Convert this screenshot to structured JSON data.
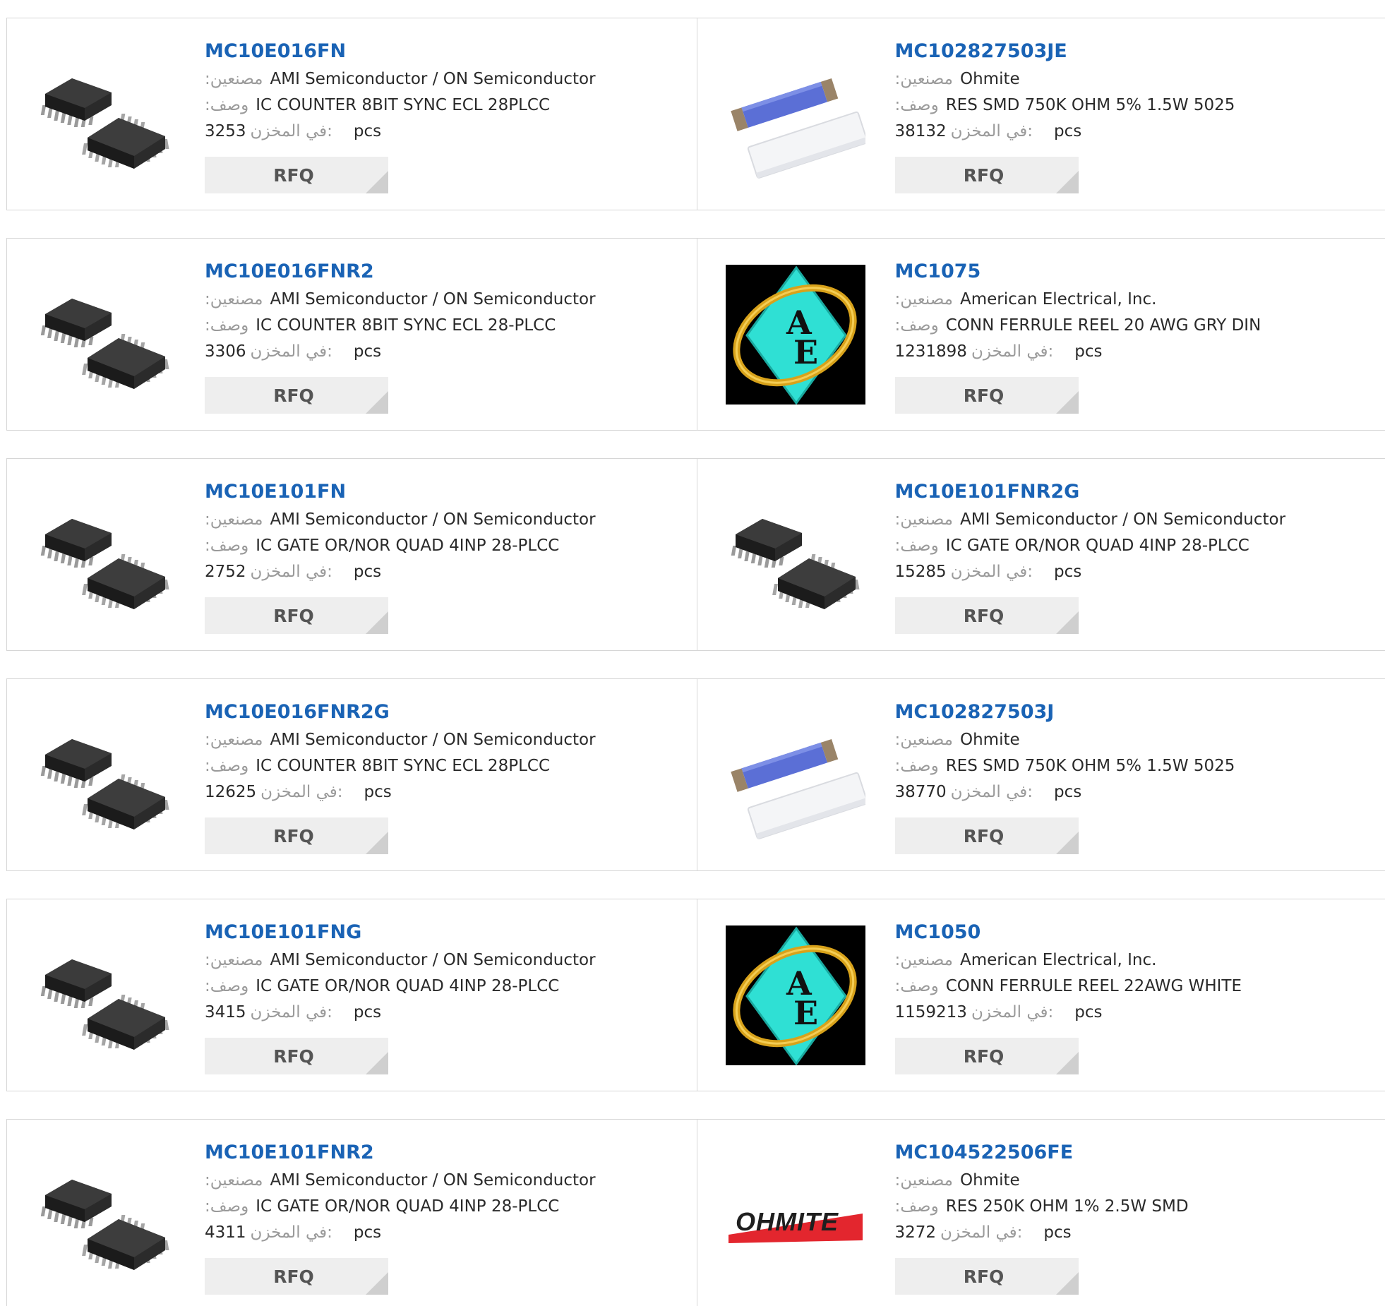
{
  "labels": {
    "manufacturer": ":مصنعين",
    "description": ":وصف",
    "stock": "في المخزن:",
    "unit": "pcs",
    "rfq": "RFQ"
  },
  "rows": [
    [
      {
        "part": "MC10E016FN",
        "image": "plcc-chip-icon",
        "manufacturer": "AMI Semiconductor / ON Semiconductor",
        "description": "IC COUNTER 8BIT SYNC ECL 28PLCC",
        "stock": "3253"
      },
      {
        "part": "MC102827503JE",
        "image": "smd-resistor-icon",
        "manufacturer": "Ohmite",
        "description": "RES SMD 750K OHM 5% 1.5W 5025",
        "stock": "38132"
      }
    ],
    [
      {
        "part": "MC10E016FNR2",
        "image": "plcc-chip-icon",
        "manufacturer": "AMI Semiconductor / ON Semiconductor",
        "description": "IC COUNTER 8BIT SYNC ECL 28-PLCC",
        "stock": "3306"
      },
      {
        "part": "MC1075",
        "image": "ae-logo-icon",
        "manufacturer": "American Electrical, Inc.",
        "description": "CONN FERRULE REEL 20 AWG GRY DIN",
        "stock": "1231898"
      }
    ],
    [
      {
        "part": "MC10E101FN",
        "image": "plcc-chip-icon",
        "manufacturer": "AMI Semiconductor / ON Semiconductor",
        "description": "IC GATE OR/NOR QUAD 4INP 28-PLCC",
        "stock": "2752"
      },
      {
        "part": "MC10E101FNR2G",
        "image": "plcc-chip-icon",
        "manufacturer": "AMI Semiconductor / ON Semiconductor",
        "description": "IC GATE OR/NOR QUAD 4INP 28-PLCC",
        "stock": "15285"
      }
    ],
    [
      {
        "part": "MC10E016FNR2G",
        "image": "plcc-chip-icon",
        "manufacturer": "AMI Semiconductor / ON Semiconductor",
        "description": "IC COUNTER 8BIT SYNC ECL 28PLCC",
        "stock": "12625"
      },
      {
        "part": "MC102827503J",
        "image": "smd-resistor-icon",
        "manufacturer": "Ohmite",
        "description": "RES SMD 750K OHM 5% 1.5W 5025",
        "stock": "38770"
      }
    ],
    [
      {
        "part": "MC10E101FNG",
        "image": "plcc-chip-icon",
        "manufacturer": "AMI Semiconductor / ON Semiconductor",
        "description": "IC GATE OR/NOR QUAD 4INP 28-PLCC",
        "stock": "3415"
      },
      {
        "part": "MC1050",
        "image": "ae-logo-icon",
        "manufacturer": "American Electrical, Inc.",
        "description": "CONN FERRULE REEL 22AWG WHITE",
        "stock": "1159213"
      }
    ],
    [
      {
        "part": "MC10E101FNR2",
        "image": "plcc-chip-icon",
        "manufacturer": "AMI Semiconductor / ON Semiconductor",
        "description": "IC GATE OR/NOR QUAD 4INP 28-PLCC",
        "stock": "4311"
      },
      {
        "part": "MC104522506FE",
        "image": "ohmite-logo-icon",
        "manufacturer": "Ohmite",
        "description": "RES 250K OHM 1% 2.5W SMD",
        "stock": "3272",
        "logo_text": "OHMITE"
      }
    ]
  ]
}
